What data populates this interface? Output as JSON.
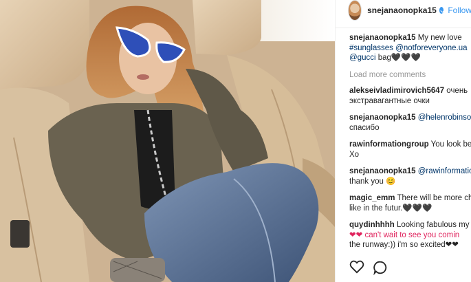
{
  "post": {
    "username": "snejanaonopka15",
    "follow_label": "Follow"
  },
  "caption": {
    "username": "snejanaonopka15",
    "text_before_hashtags": "My new love ",
    "hashtag_1": "#sunglasses",
    "hashtag_2": "@notforeveryone.ua",
    "mention": "@gucci",
    "text_after": " bag🖤🖤🖤"
  },
  "load_more": "Load more comments",
  "comments": [
    {
      "username": "alekseivladimirovich5647",
      "text": "очень экстравагантные очки"
    },
    {
      "username": "snejanaonopka15",
      "mention": "@helenrobinson",
      "text": "спасибо"
    },
    {
      "username": "rawinformationgroup",
      "text": "You look be",
      "text2": "Xo"
    },
    {
      "username": "snejanaonopka15",
      "mention": "@rawinformatio",
      "text": "thank you 😊"
    },
    {
      "username": "magic_emm",
      "text": "There will be more ch",
      "text2": "like in the futur.🖤🖤🖤"
    },
    {
      "username": "quydinhhhh",
      "text": "Looking fabulous my",
      "text2": "❤❤ can't wait to see you comin",
      "text3": "the runway:)) i'm so excited❤❤"
    }
  ],
  "icons": {
    "like": "heart-outline-icon",
    "comment": "comment-bubble-icon",
    "verified": "verified-badge-icon"
  },
  "colors": {
    "link": "#003569",
    "follow": "#3897f0",
    "text": "#262626",
    "muted": "#999999"
  }
}
